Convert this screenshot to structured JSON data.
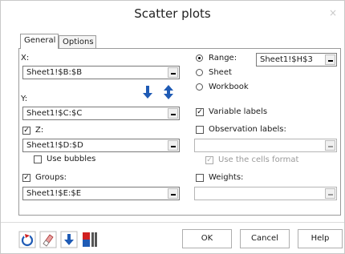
{
  "window": {
    "title": "Scatter plots",
    "close": "×"
  },
  "tabs": [
    {
      "label": "General"
    },
    {
      "label": "Options"
    }
  ],
  "left": {
    "x_label": "X:",
    "x_value": "Sheet1!$B:$B",
    "y_label": "Y:",
    "y_value": "Sheet1!$C:$C",
    "z_label": "Z:",
    "z_value": "Sheet1!$D:$D",
    "z_checked": true,
    "use_bubbles_label": "Use bubbles",
    "use_bubbles_checked": false,
    "groups_label": "Groups:",
    "groups_value": "Sheet1!$E:$E",
    "groups_checked": true
  },
  "right": {
    "range_label": "Range:",
    "range_value": "Sheet1!$H$3",
    "range_selected": true,
    "sheet_label": "Sheet",
    "workbook_label": "Workbook",
    "variable_labels_label": "Variable labels",
    "variable_labels_checked": true,
    "observation_labels_label": "Observation labels:",
    "observation_labels_checked": false,
    "observation_labels_value": "",
    "use_cells_format_label": "Use the cells format",
    "use_cells_format_checked": true,
    "weights_label": "Weights:",
    "weights_checked": false,
    "weights_value": ""
  },
  "footer": {
    "ok": "OK",
    "cancel": "Cancel",
    "help": "Help"
  },
  "colors": {
    "accent_blue": "#1f5bb5",
    "accent_red": "#d02020"
  }
}
